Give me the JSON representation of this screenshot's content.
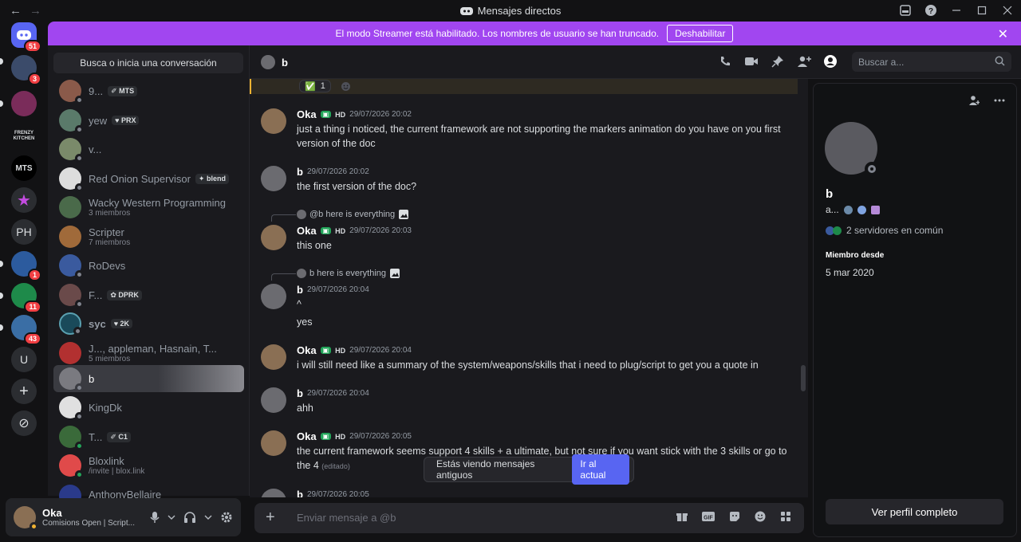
{
  "window": {
    "title": "Mensajes directos",
    "nav_back": "←",
    "nav_forward": "→"
  },
  "rail": {
    "items": [
      {
        "label": "",
        "badge": "51",
        "color": "#5865f2"
      },
      {
        "label": "",
        "badge": "3",
        "color": "#3b4b6a"
      },
      {
        "label": "",
        "badge": "",
        "color": "#7a2c5a"
      },
      {
        "label": "FRENZY KITCHEN",
        "badge": "",
        "color": "#121214"
      },
      {
        "label": "MTS",
        "badge": "",
        "color": "#000000"
      },
      {
        "label": "★",
        "badge": "",
        "color": "#2b2d31"
      },
      {
        "label": "PH",
        "badge": "",
        "color": "#2b2d31"
      },
      {
        "label": "",
        "badge": "1",
        "color": "#2c5b9e"
      },
      {
        "label": "",
        "badge": "11",
        "color": "#1e8a4a"
      },
      {
        "label": "",
        "badge": "43",
        "color": "#3a6ea5"
      },
      {
        "label": "U",
        "badge": "",
        "color": "#2b2d31"
      },
      {
        "label": "+",
        "badge": "",
        "color": "#2b2d31"
      },
      {
        "label": "⊘",
        "badge": "",
        "color": "#2b2d31"
      }
    ]
  },
  "banner": {
    "text": "El modo Streamer está habilitado. Los nombres de usuario se han truncado.",
    "button": "Deshabilitar",
    "close": "✕"
  },
  "dmlist": {
    "search": "Busca o inicia una conversación",
    "items": [
      {
        "name": "9...",
        "tag": "✐ MTS",
        "sub": "",
        "online": false,
        "color": "#8a5a4a"
      },
      {
        "name": "yew",
        "tag": "♥ PRX",
        "sub": "",
        "online": false,
        "color": "#5a7a6a"
      },
      {
        "name": "v...",
        "tag": "",
        "sub": "",
        "online": false,
        "color": "#7a8a6a"
      },
      {
        "name": "Red Onion Supervisor",
        "tag": "✦ blend",
        "sub": "",
        "online": false,
        "color": "#dddddd"
      },
      {
        "name": "Wacky Western Programming",
        "tag": "",
        "sub": "3 miembros",
        "online": false,
        "color": "#4a6a4a"
      },
      {
        "name": "Scripter",
        "tag": "",
        "sub": "7 miembros",
        "online": false,
        "color": "#a06a3a"
      },
      {
        "name": "RoDevs",
        "tag": "",
        "sub": "",
        "online": false,
        "color": "#3a5a9e"
      },
      {
        "name": "F...",
        "tag": "✿ DPRK",
        "sub": "",
        "online": false,
        "color": "#6a4a4a"
      },
      {
        "name": "syc",
        "tag": "♥ 2K",
        "sub": "",
        "online": false,
        "color": "#1a4a5a"
      },
      {
        "name": "J..., appleman, Hasnain, T...",
        "tag": "",
        "sub": "5 miembros",
        "online": false,
        "color": "#b23030"
      },
      {
        "name": "b",
        "tag": "",
        "sub": "",
        "online": false,
        "color": "#7a7a80",
        "active": true
      },
      {
        "name": "KingDk",
        "tag": "",
        "sub": "",
        "online": false,
        "color": "#e0e0e0"
      },
      {
        "name": "T...",
        "tag": "✐ C1",
        "sub": "",
        "online": true,
        "color": "#3a6a3a"
      },
      {
        "name": "Bloxlink",
        "tag": "",
        "sub": "/invite | blox.link",
        "online": true,
        "color": "#e04a4a"
      },
      {
        "name": "AnthonyBellaire",
        "tag": "",
        "sub": "",
        "online": false,
        "color": "#2a3a8a"
      }
    ]
  },
  "user": {
    "name": "Oka",
    "status": "Comisions Open | Script..."
  },
  "chat": {
    "recipient": "b",
    "search_placeholder": "Buscar a...",
    "reaction": {
      "emoji": "✅",
      "count": "1"
    },
    "messages": [
      {
        "user": "Oka",
        "hd": true,
        "time": "29/07/2026 20:02",
        "body": "just a thing i noticed, the current framework are not supporting the markers animation do you have on you first version of the doc",
        "reply": "",
        "edited": ""
      },
      {
        "user": "b",
        "hd": false,
        "time": "29/07/2026 20:02",
        "body": "the first version of the doc?",
        "reply": "",
        "edited": ""
      },
      {
        "user": "Oka",
        "hd": true,
        "time": "29/07/2026 20:03",
        "body": "this one",
        "reply": "@b here is everything",
        "edited": ""
      },
      {
        "user": "b",
        "hd": false,
        "time": "29/07/2026 20:04",
        "body": "^",
        "reply": "b here is everything",
        "edited": ""
      },
      {
        "user": "",
        "hd": false,
        "time": "",
        "body": "yes",
        "reply": "",
        "edited": ""
      },
      {
        "user": "Oka",
        "hd": true,
        "time": "29/07/2026 20:04",
        "body": "i will still need like a summary of the system/weapons/skills that i need to plug/script to get you a quote in",
        "reply": "",
        "edited": ""
      },
      {
        "user": "b",
        "hd": false,
        "time": "29/07/2026 20:04",
        "body": "ahh",
        "reply": "",
        "edited": ""
      },
      {
        "user": "Oka",
        "hd": true,
        "time": "29/07/2026 20:05",
        "body": "the current framework seems support 4 skills + a ultimate, but not sure if you want stick with the 3 skills or go to the 4",
        "reply": "",
        "edited": "(editado)"
      },
      {
        "user": "b",
        "hd": false,
        "time": "29/07/2026 20:05",
        "body": "",
        "reply": "",
        "edited": ""
      }
    ],
    "hd_label": "HD",
    "old_notice": "Estás viendo mensajes antiguos",
    "jump_label": "Ir al actual",
    "composer_placeholder": "Enviar mensaje a @b"
  },
  "profile": {
    "name": "b",
    "tag": "a...",
    "common": "2 servidores en común",
    "since_header": "Miembro desde",
    "since": "5 mar 2020",
    "full_profile": "Ver perfil completo"
  }
}
